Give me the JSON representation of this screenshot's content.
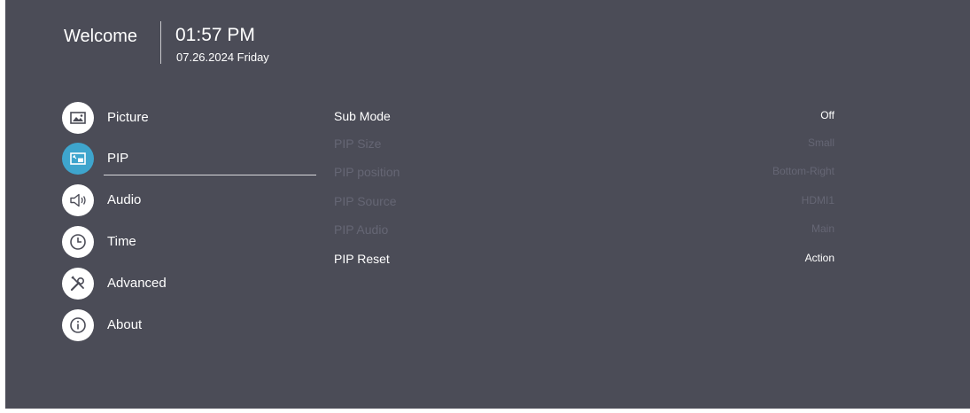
{
  "header": {
    "welcome": "Welcome",
    "time": "01:57 PM",
    "date": "07.26.2024 Friday"
  },
  "menu": [
    {
      "label": "Picture",
      "icon": "picture-icon"
    },
    {
      "label": "PIP",
      "icon": "pip-icon",
      "active": true
    },
    {
      "label": "Audio",
      "icon": "speaker-icon"
    },
    {
      "label": "Time",
      "icon": "clock-icon"
    },
    {
      "label": "Advanced",
      "icon": "tools-icon"
    },
    {
      "label": "About",
      "icon": "info-icon"
    }
  ],
  "settings": [
    {
      "label": "Sub Mode",
      "value": "Off",
      "enabled": true
    },
    {
      "label": "PIP Size",
      "value": "Small",
      "enabled": false
    },
    {
      "label": "PIP position",
      "value": "Bottom-Right",
      "enabled": false
    },
    {
      "label": "PIP Source",
      "value": "HDMI1",
      "enabled": false
    },
    {
      "label": "PIP Audio",
      "value": "Main",
      "enabled": false
    },
    {
      "label": "PIP Reset",
      "value": "Action",
      "enabled": true
    }
  ],
  "colors": {
    "background": "#4b4c57",
    "accent": "#3ea5cd",
    "text": "#ffffff",
    "disabled_text": "#656674"
  }
}
